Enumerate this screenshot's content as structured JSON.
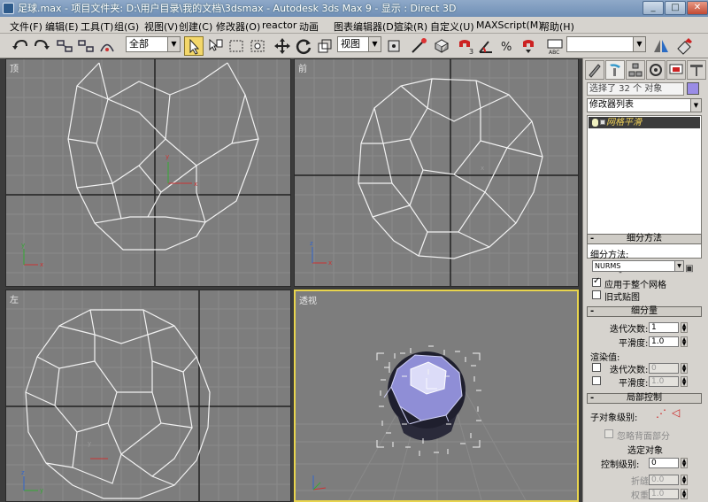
{
  "window": {
    "title": "足球.max  - 项目文件夹: D:\\用户目录\\我的文档\\3dsmax   - Autodesk 3ds Max 9   - 显示 : Direct 3D",
    "minimize": "_",
    "maximize": "□",
    "close": "✕"
  },
  "menu": [
    "文件(F)",
    "编辑(E)",
    "工具(T)",
    "组(G)",
    "视图(V)",
    "创建(C)",
    "修改器(O)",
    "reactor",
    "动画",
    "图表编辑器(D)",
    "渲染(R)",
    "自定义(U)",
    "MAXScript(M)",
    "帮助(H)"
  ],
  "toolbar": {
    "selection_filter": "全部",
    "ref_coord": "视图"
  },
  "viewports": {
    "top": "顶",
    "front": "前",
    "left": "左",
    "perspective": "透视"
  },
  "command_panel": {
    "selection_text": "选择了 32 个 对象",
    "selection_color": "#9a8ce6",
    "modifier_list": "修改器列表",
    "stack_item": "网格平滑",
    "subdivision_method": {
      "header": "细分方法",
      "label": "细分方法:",
      "value": "NURMS",
      "apply_whole": "应用于整个网格",
      "old_style": "旧式贴图"
    },
    "subdivision_amount": {
      "header": "细分量",
      "iterations_label": "迭代次数:",
      "iterations": "1",
      "smoothness_label": "平滑度:",
      "smoothness": "1.0",
      "render_label": "渲染值:",
      "render_iterations_label": "迭代次数:",
      "render_iterations": "0",
      "render_smoothness_label": "平滑度:",
      "render_smoothness": "1.0"
    },
    "local_control": {
      "header": "局部控制",
      "sublevel_label": "子对象级别:",
      "ignore_backfacing": "忽略背面部分",
      "control_object": "选定对象",
      "control_level_label": "控制级别:",
      "control_level": "0",
      "crease_label": "折缝:",
      "crease": "0.0",
      "weight_label": "权重:",
      "weight": "1.0"
    }
  }
}
